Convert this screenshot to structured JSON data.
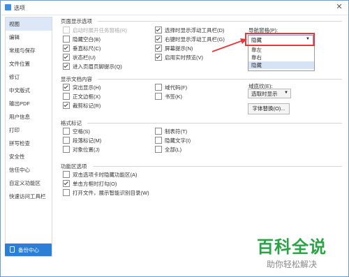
{
  "window": {
    "title": "选项"
  },
  "sidebar": {
    "items": [
      {
        "label": "视图",
        "active": true
      },
      {
        "label": "编辑"
      },
      {
        "label": "常规与保存"
      },
      {
        "label": "文件位置"
      },
      {
        "label": "修订"
      },
      {
        "label": "中文版式"
      },
      {
        "label": "输出PDF"
      },
      {
        "label": "用户信息"
      },
      {
        "label": "打印"
      },
      {
        "label": "拼写检查"
      },
      {
        "label": "安全性"
      },
      {
        "label": "信任中心"
      },
      {
        "label": "自定义功能区"
      },
      {
        "label": "快速访问工具栏"
      }
    ],
    "backup_label": "备份中心"
  },
  "page_display": {
    "title": "页面显示选项",
    "col1": [
      {
        "label": "启动时展开任务窗格(R)",
        "checked": false,
        "disabled": true
      },
      {
        "label": "隐藏空白(B)",
        "checked": false
      },
      {
        "label": "垂直标尺(C)",
        "checked": true
      },
      {
        "label": "状态栏(U)",
        "checked": true
      },
      {
        "label": "进入页眉页脚提示(Q)",
        "checked": true
      }
    ],
    "col2": [
      {
        "label": "选择时显示浮动工具栏(D)",
        "checked": true
      },
      {
        "label": "右键时显示浮动工具栏(G)",
        "checked": true
      },
      {
        "label": "屏幕提示(N)",
        "checked": true
      },
      {
        "label": "启用实时预览(V)",
        "checked": true
      }
    ],
    "nav_label": "导航窗格(P):",
    "nav_value": "隐藏",
    "nav_options": [
      "靠左",
      "靠右",
      "隐藏"
    ]
  },
  "doc_content": {
    "title": "显示文档内容",
    "col1": [
      {
        "label": "突出显示(H)",
        "checked": true
      },
      {
        "label": "正文边框(X)",
        "checked": false
      },
      {
        "label": "裁剪标记(R)",
        "checked": true
      }
    ],
    "col2": [
      {
        "label": "域代码(F)",
        "checked": false
      },
      {
        "label": "书签(K)",
        "checked": false
      }
    ],
    "field_label": "域底纹(E):",
    "field_value": "选取时显示",
    "font_button": "字体替换(O)..."
  },
  "format_marks": {
    "title": "格式标记",
    "col1": [
      {
        "label": "空格(S)",
        "checked": false
      },
      {
        "label": "段落标记(M)",
        "checked": false
      },
      {
        "label": "对象位置(J)",
        "checked": false
      }
    ],
    "col2": [
      {
        "label": "制表符(T)",
        "checked": false
      },
      {
        "label": "隐藏文字(I)",
        "checked": false
      },
      {
        "label": "全部(L)",
        "checked": false
      }
    ]
  },
  "ribbon": {
    "title": "功能区选项",
    "items": [
      {
        "label": "双击选项卡时隐藏功能区(A)",
        "checked": false
      },
      {
        "label": "单击方框时打勾(O)",
        "checked": true
      },
      {
        "label": "打开文件，展示智能识别目录(W)",
        "checked": false
      }
    ]
  },
  "watermark": {
    "main": "百科全说",
    "sub": "助你轻松解决"
  },
  "colors": {
    "accent": "#2b7fd6",
    "annotation": "#e5383b",
    "watermark": "#2ba245"
  }
}
